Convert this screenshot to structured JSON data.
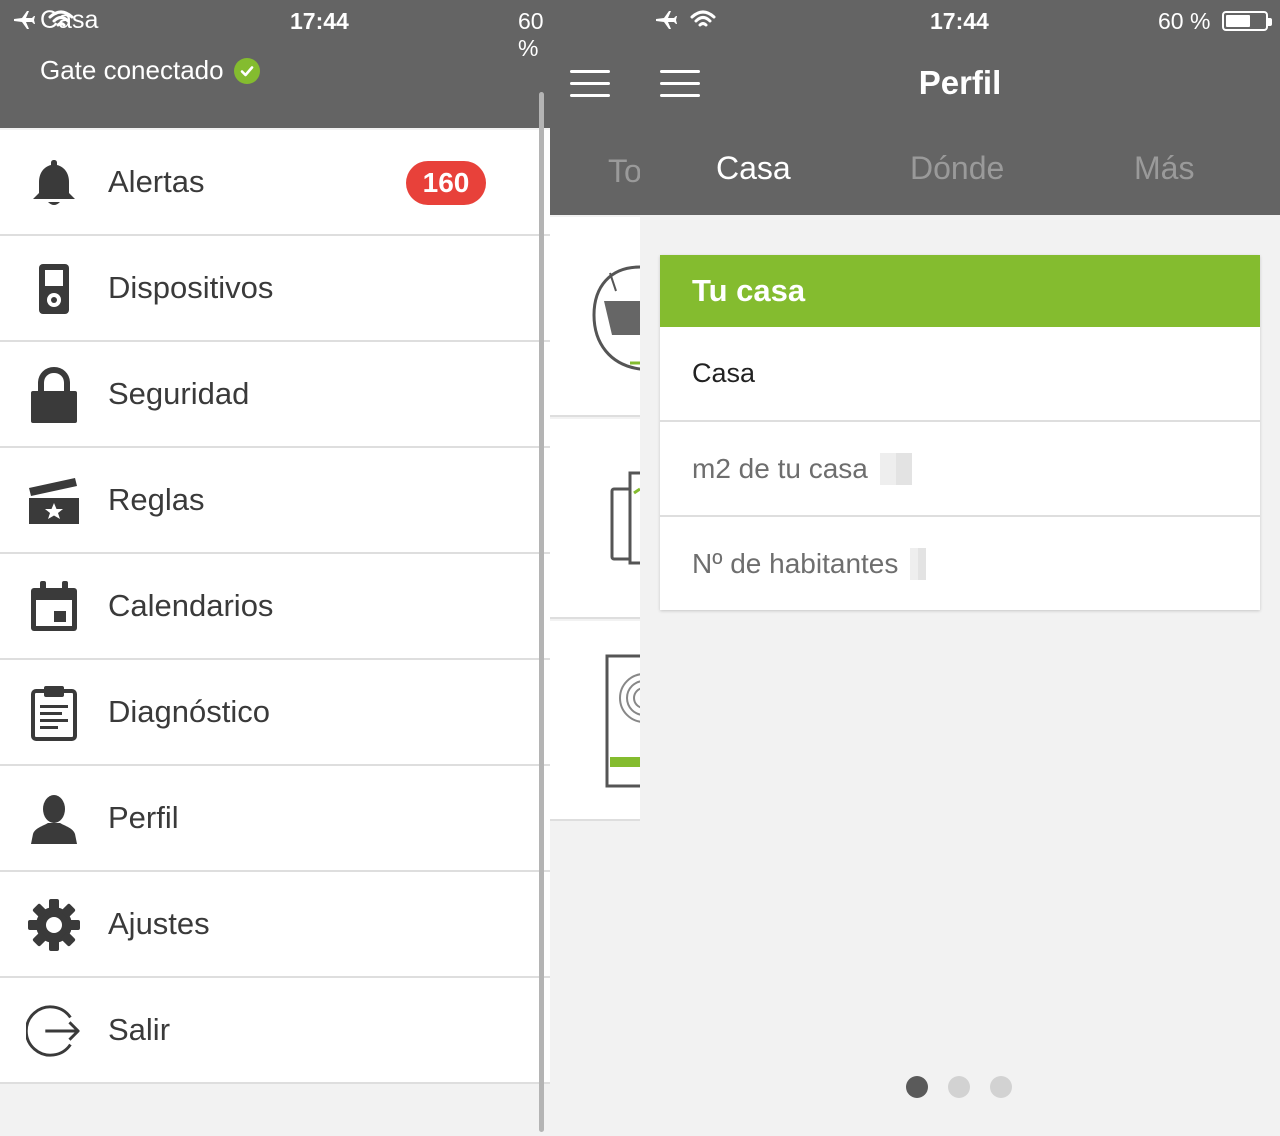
{
  "status_bar_left": {
    "home_name": "Casa",
    "time": "17:44",
    "battery": "60 %"
  },
  "status_bar_right": {
    "time": "17:44",
    "battery": "60 %"
  },
  "side_menu": {
    "gate_status": "Gate conectado",
    "items": [
      {
        "label": "Alertas",
        "icon": "bell-icon",
        "badge": "160"
      },
      {
        "label": "Dispositivos",
        "icon": "device-icon"
      },
      {
        "label": "Seguridad",
        "icon": "lock-icon"
      },
      {
        "label": "Reglas",
        "icon": "rules-icon"
      },
      {
        "label": "Calendarios",
        "icon": "calendar-icon"
      },
      {
        "label": "Diagnóstico",
        "icon": "clipboard-icon"
      },
      {
        "label": "Perfil",
        "icon": "user-icon"
      },
      {
        "label": "Ajustes",
        "icon": "gear-icon"
      },
      {
        "label": "Salir",
        "icon": "logout-icon"
      }
    ]
  },
  "middle": {
    "tab_partial": "To"
  },
  "perfil": {
    "title": "Perfil",
    "tabs": [
      {
        "label": "Casa",
        "active": true
      },
      {
        "label": "Dónde",
        "active": false
      },
      {
        "label": "Más",
        "active": false
      }
    ],
    "card": {
      "header": "Tu casa",
      "rows": [
        {
          "label": "Casa"
        },
        {
          "label": "m2 de tu casa"
        },
        {
          "label": "Nº de habitantes"
        }
      ]
    },
    "pager": {
      "total": 3,
      "current": 1
    }
  },
  "colors": {
    "header_gray": "#646464",
    "accent_green": "#84bc2f",
    "badge_red": "#e8413a"
  }
}
